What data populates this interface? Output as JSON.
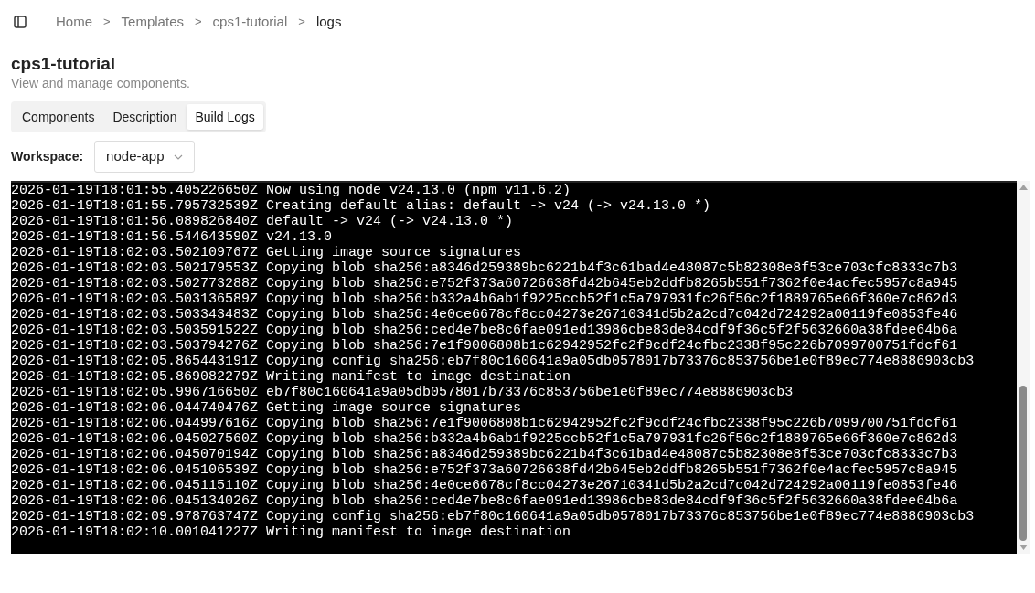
{
  "breadcrumb": [
    {
      "label": "Home",
      "current": false
    },
    {
      "label": "Templates",
      "current": false
    },
    {
      "label": "cps1-tutorial",
      "current": false
    },
    {
      "label": "logs",
      "current": true
    }
  ],
  "separator": ">",
  "page": {
    "title": "cps1-tutorial",
    "subtitle": "View and manage components."
  },
  "tabs": [
    {
      "label": "Components",
      "selected": false
    },
    {
      "label": "Description",
      "selected": false
    },
    {
      "label": "Build Logs",
      "selected": true
    }
  ],
  "workspace": {
    "label": "Workspace:",
    "value": "node-app"
  },
  "log_lines": [
    "2026-01-19T18:01:55.405226650Z Now using node v24.13.0 (npm v11.6.2)",
    "2026-01-19T18:01:55.795732539Z Creating default alias: default -> v24 (-> v24.13.0 *)",
    "2026-01-19T18:01:56.089826840Z default -> v24 (-> v24.13.0 *)",
    "2026-01-19T18:01:56.544643590Z v24.13.0",
    "2026-01-19T18:02:03.502109767Z Getting image source signatures",
    "2026-01-19T18:02:03.502179553Z Copying blob sha256:a8346d259389bc6221b4f3c61bad4e48087c5b82308e8f53ce703cfc8333c7b3",
    "2026-01-19T18:02:03.502773288Z Copying blob sha256:e752f373a60726638fd42b645eb2ddfb8265b551f7362f0e4acfec5957c8a945",
    "2026-01-19T18:02:03.503136589Z Copying blob sha256:b332a4b6ab1f9225ccb52f1c5a797931fc26f56c2f1889765e66f360e7c862d3",
    "2026-01-19T18:02:03.503343483Z Copying blob sha256:4e0ce6678cf8cc04273e26710341d5b2a2cd7c042d724292a00119fe0853fe46",
    "2026-01-19T18:02:03.503591522Z Copying blob sha256:ced4e7be8c6fae091ed13986cbe83de84cdf9f36c5f2f5632660a38fdee64b6a",
    "2026-01-19T18:02:03.503794276Z Copying blob sha256:7e1f9006808b1c62942952fc2f9cdf24cfbc2338f95c226b7099700751fdcf61",
    "2026-01-19T18:02:05.865443191Z Copying config sha256:eb7f80c160641a9a05db0578017b73376c853756be1e0f89ec774e8886903cb3",
    "2026-01-19T18:02:05.869082279Z Writing manifest to image destination",
    "2026-01-19T18:02:05.996716650Z eb7f80c160641a9a05db0578017b73376c853756be1e0f89ec774e8886903cb3",
    "2026-01-19T18:02:06.044740476Z Getting image source signatures",
    "2026-01-19T18:02:06.044997616Z Copying blob sha256:7e1f9006808b1c62942952fc2f9cdf24cfbc2338f95c226b7099700751fdcf61",
    "2026-01-19T18:02:06.045027560Z Copying blob sha256:b332a4b6ab1f9225ccb52f1c5a797931fc26f56c2f1889765e66f360e7c862d3",
    "2026-01-19T18:02:06.045070194Z Copying blob sha256:a8346d259389bc6221b4f3c61bad4e48087c5b82308e8f53ce703cfc8333c7b3",
    "2026-01-19T18:02:06.045106539Z Copying blob sha256:e752f373a60726638fd42b645eb2ddfb8265b551f7362f0e4acfec5957c8a945",
    "2026-01-19T18:02:06.045115110Z Copying blob sha256:4e0ce6678cf8cc04273e26710341d5b2a2cd7c042d724292a00119fe0853fe46",
    "2026-01-19T18:02:06.045134026Z Copying blob sha256:ced4e7be8c6fae091ed13986cbe83de84cdf9f36c5f2f5632660a38fdee64b6a",
    "2026-01-19T18:02:09.978763747Z Copying config sha256:eb7f80c160641a9a05db0578017b73376c853756be1e0f89ec774e8886903cb3",
    "2026-01-19T18:02:10.001041227Z Writing manifest to image destination"
  ]
}
